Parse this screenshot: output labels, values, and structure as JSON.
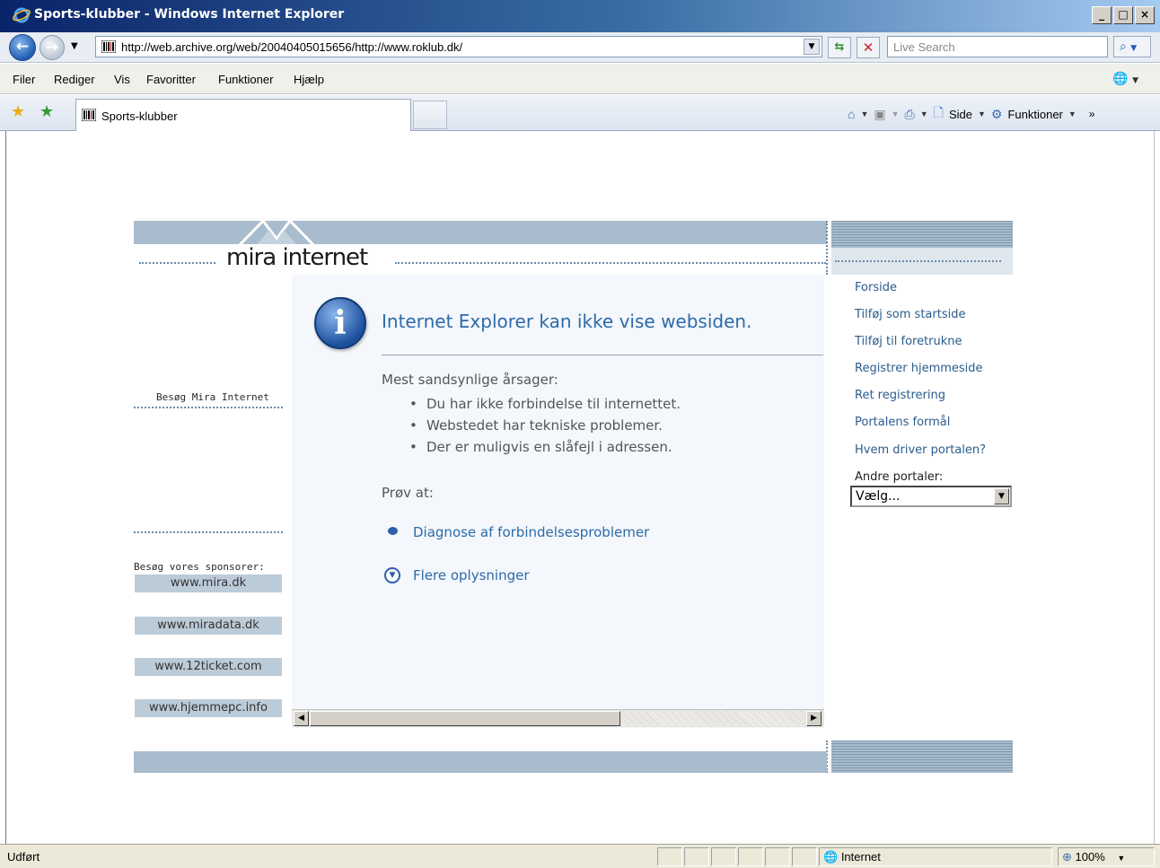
{
  "window": {
    "title": "Sports-klubber - Windows Internet Explorer",
    "btn_min": "_",
    "btn_max": "□",
    "btn_close": "×"
  },
  "address": {
    "url": "http://web.archive.org/web/20040405015656/http://www.roklub.dk/",
    "search_placeholder": "Live Search"
  },
  "menu": [
    "Filer",
    "Rediger",
    "Vis",
    "Favoritter",
    "Funktioner",
    "Hjælp"
  ],
  "tab": {
    "label": "Sports-klubber"
  },
  "commandbar": {
    "side": "Side",
    "funktioner": "Funktioner"
  },
  "page": {
    "logo_text": "mira internet",
    "visit_mira": "Besøg Mira Internet",
    "sponsor_title": "Besøg vores sponsorer:",
    "sponsors": [
      "www.mira.dk",
      "www.miradata.dk",
      "www.12ticket.com",
      "www.hjemmepc.info"
    ],
    "nav": [
      "Forside",
      "Tilføj som startside",
      "Tilføj til foretrukne",
      "Registrer hjemmeside",
      "Ret registrering",
      "Portalens formål",
      "Hvem driver portalen?"
    ],
    "other_portals_label": "Andre portaler:",
    "other_portals_value": "Vælg..."
  },
  "error": {
    "title": "Internet Explorer kan ikke vise websiden.",
    "causes_heading": "Mest sandsynlige årsager:",
    "causes": [
      "Du har ikke forbindelse til internettet.",
      "Webstedet har tekniske problemer.",
      "Der er muligvis en slåfejl i adressen."
    ],
    "try_heading": "Prøv at:",
    "diagnose_link": "Diagnose af forbindelsesproblemer",
    "more_info_link": "Flere oplysninger"
  },
  "status": {
    "text": "Udført",
    "zone": "Internet",
    "zoom": "100%"
  },
  "colors": {
    "band": "#a8bccd",
    "link": "#2d6aa8",
    "titlebar": "#0a246a"
  }
}
